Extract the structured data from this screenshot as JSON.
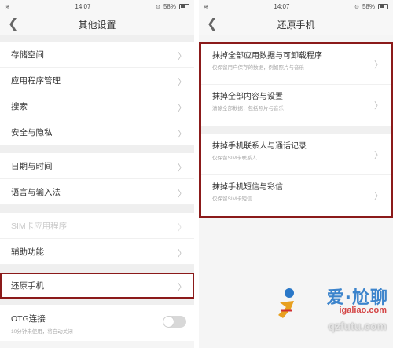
{
  "status": {
    "time": "14:07",
    "battery": "58%"
  },
  "left": {
    "title": "其他设置",
    "rows": [
      {
        "label": "存储空间"
      },
      {
        "label": "应用程序管理"
      },
      {
        "label": "搜索"
      },
      {
        "label": "安全与隐私"
      },
      {
        "label": "日期与时间"
      },
      {
        "label": "语言与输入法"
      },
      {
        "label": "SIM卡应用程序"
      },
      {
        "label": "辅助功能"
      },
      {
        "label": "还原手机"
      }
    ],
    "otg": {
      "label": "OTG连接",
      "sub": "10分钟未使用，将自动关闭"
    }
  },
  "right": {
    "title": "还原手机",
    "items": [
      {
        "label": "抹掉全部应用数据与可卸载程序",
        "sub": "仅保留用户保存的数据，例如照片与音乐"
      },
      {
        "label": "抹掉全部内容与设置",
        "sub": "清除全部数据，包括照片与音乐"
      },
      {
        "label": "抹掉手机联系人与通话记录",
        "sub": "仅保留SIM卡联系人"
      },
      {
        "label": "抹掉手机短信与彩信",
        "sub": "仅保留SIM卡短信"
      }
    ]
  },
  "watermark": {
    "main": "爱·尬聊",
    "url": "igaliao.com",
    "url2": "qzfutu.com"
  },
  "colors": {
    "highlight": "#8b1a1a",
    "background": "#f5f5f5"
  }
}
